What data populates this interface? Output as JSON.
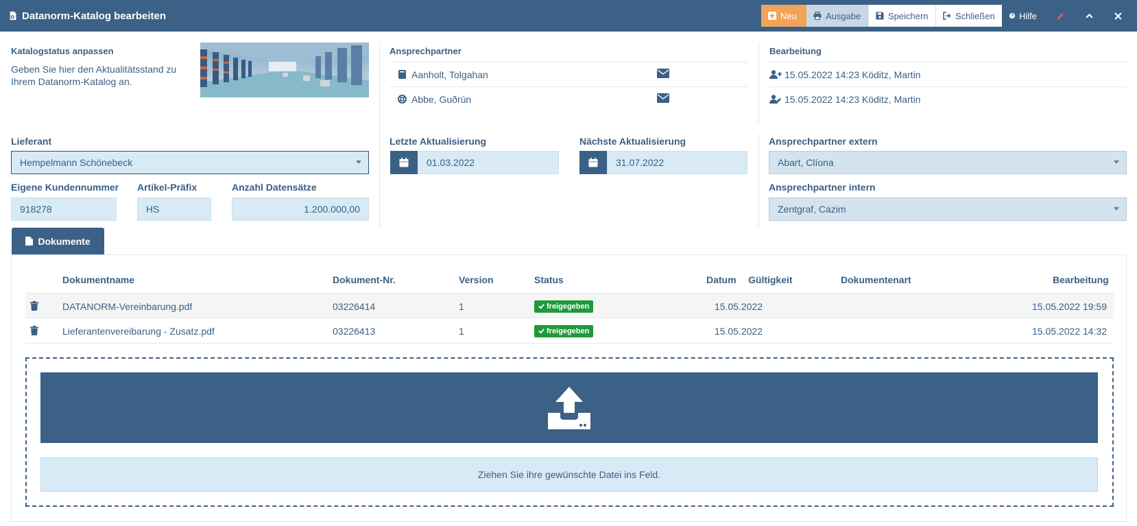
{
  "header": {
    "title": "Datanorm-Katalog bearbeiten",
    "buttons": {
      "neu": "Neu",
      "ausgabe": "Ausgabe",
      "speichern": "Speichern",
      "schliessen": "Schließen",
      "hilfe": "Hilfe"
    },
    "colors": {
      "bar": "#3b6186",
      "neu": "#f2a35a",
      "ausgabe": "#c8d7e6"
    }
  },
  "katalogstatus": {
    "heading": "Katalogstatus anpassen",
    "description_line1": "Geben Sie hier den Aktualitätsstand zu",
    "description_line2": "Ihrem Datanorm-Katalog an."
  },
  "ansprechpartner": {
    "heading": "Ansprechpartner",
    "contacts": [
      {
        "name": "Aanholt, Tolgahan",
        "icon": "address-book-icon"
      },
      {
        "name": "Abbe, Guðrún",
        "icon": "life-ring-icon"
      }
    ]
  },
  "bearbeitung": {
    "heading": "Bearbeitung",
    "entries": [
      {
        "text": "15.05.2022 14:23 Köditz, Martin",
        "icon": "user-plus-icon"
      },
      {
        "text": "15.05.2022 14:23 Köditz, Martin",
        "icon": "user-edit-icon"
      }
    ]
  },
  "form": {
    "lieferant_label": "Lieferant",
    "lieferant_value": "Hempelmann Schönebeck",
    "kundennummer_label": "Eigene Kundennummer",
    "kundennummer_value": "918278",
    "praefix_label": "Artikel-Präfix",
    "praefix_value": "HS",
    "datensaetze_label": "Anzahl Datensätze",
    "datensaetze_value": "1.200.000,00",
    "letzte_label": "Letzte Aktualisierung",
    "letzte_value": "01.03.2022",
    "naechste_label": "Nächste Aktualisierung",
    "naechste_value": "31.07.2022",
    "extern_label": "Ansprechpartner extern",
    "extern_value": "Abart, Clíona",
    "intern_label": "Ansprechpartner intern",
    "intern_value": "Zentgraf, Cazim"
  },
  "tabs": {
    "dokumente": "Dokumente"
  },
  "table": {
    "headers": {
      "name": "Dokumentname",
      "nr": "Dokument-Nr.",
      "version": "Version",
      "status": "Status",
      "datum": "Datum",
      "gueltigkeit": "Gültigkeit",
      "art": "Dokumentenart",
      "bearbeitung": "Bearbeitung"
    },
    "rows": [
      {
        "name": "DATANORM-Vereinbarung.pdf",
        "nr": "03226414",
        "version": "1",
        "status": "freigegeben",
        "datum": "15.05.2022",
        "gueltigkeit": "",
        "art": "",
        "bearbeitung": "15.05.2022 19:59"
      },
      {
        "name": "Lieferantenvereibarung - Zusatz.pdf",
        "nr": "03226413",
        "version": "1",
        "status": "freigegeben",
        "datum": "15.05.2022",
        "gueltigkeit": "",
        "art": "",
        "bearbeitung": "15.05.2022 14:32"
      }
    ],
    "status_color": "#1f9a3a"
  },
  "dropzone": {
    "icon": "upload-icon",
    "message": "Ziehen Sie ihre gewünschte Datei ins Feld."
  }
}
